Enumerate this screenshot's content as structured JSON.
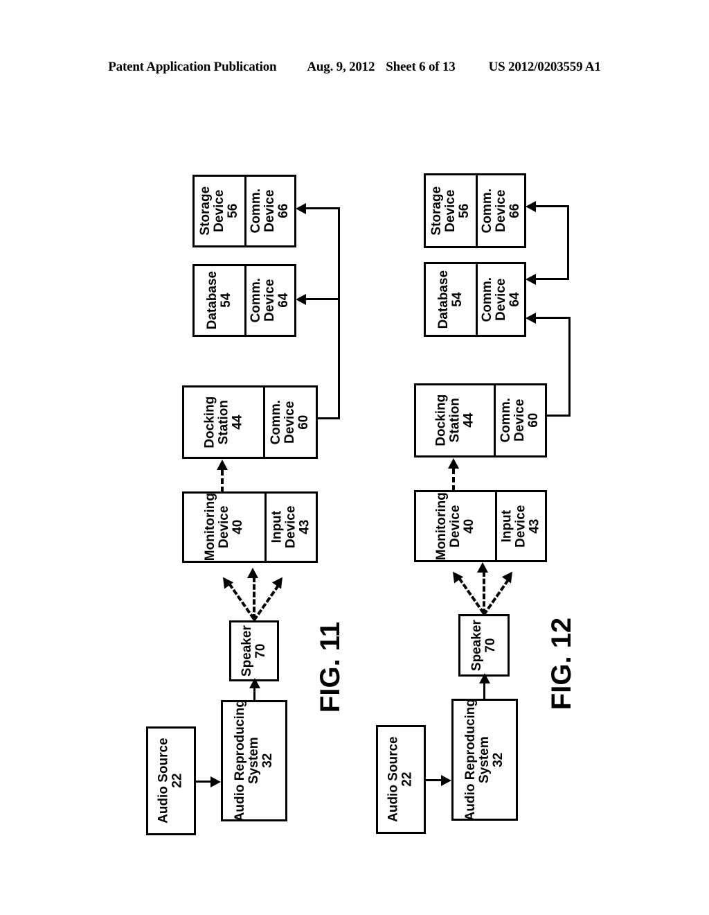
{
  "header": {
    "publication": "Patent Application Publication",
    "date": "Aug. 9, 2012",
    "sheet": "Sheet 6 of 13",
    "number": "US 2012/0203559 A1"
  },
  "figures": [
    {
      "id": "fig11",
      "caption": "FIG. 11",
      "blocks": {
        "storage": {
          "left": "Storage\nDevice\n56",
          "right": "Comm.\nDevice\n66"
        },
        "database": {
          "left": "Database\n54",
          "right": "Comm.\nDevice\n64"
        },
        "docking": {
          "left": "Docking\nStation\n44",
          "right": "Comm.\nDevice\n60"
        },
        "monitoring": {
          "left": "Monitoring\nDevice\n40",
          "right": "Input\nDevice\n43"
        },
        "speaker": {
          "left": "Speaker\n70"
        },
        "audio_source": {
          "left": "Audio Source\n22"
        },
        "audio_reproducing": {
          "left": "Audio Reproducing\nSystem\n32"
        }
      }
    },
    {
      "id": "fig12",
      "caption": "FIG. 12",
      "blocks": {
        "storage": {
          "left": "Storage\nDevice\n56",
          "right": "Comm.\nDevice\n66"
        },
        "database": {
          "left": "Database\n54",
          "right": "Comm.\nDevice\n64"
        },
        "docking": {
          "left": "Docking\nStation\n44",
          "right": "Comm.\nDevice\n60"
        },
        "monitoring": {
          "left": "Monitoring\nDevice\n40",
          "right": "Input\nDevice\n43"
        },
        "speaker": {
          "left": "Speaker\n70"
        },
        "audio_source": {
          "left": "Audio Source\n22"
        },
        "audio_reproducing": {
          "left": "Audio Reproducing\nSystem\n32"
        }
      }
    }
  ],
  "colors": {
    "ink": "#000000",
    "paper": "#ffffff",
    "shadow": "#7d7d7d"
  }
}
